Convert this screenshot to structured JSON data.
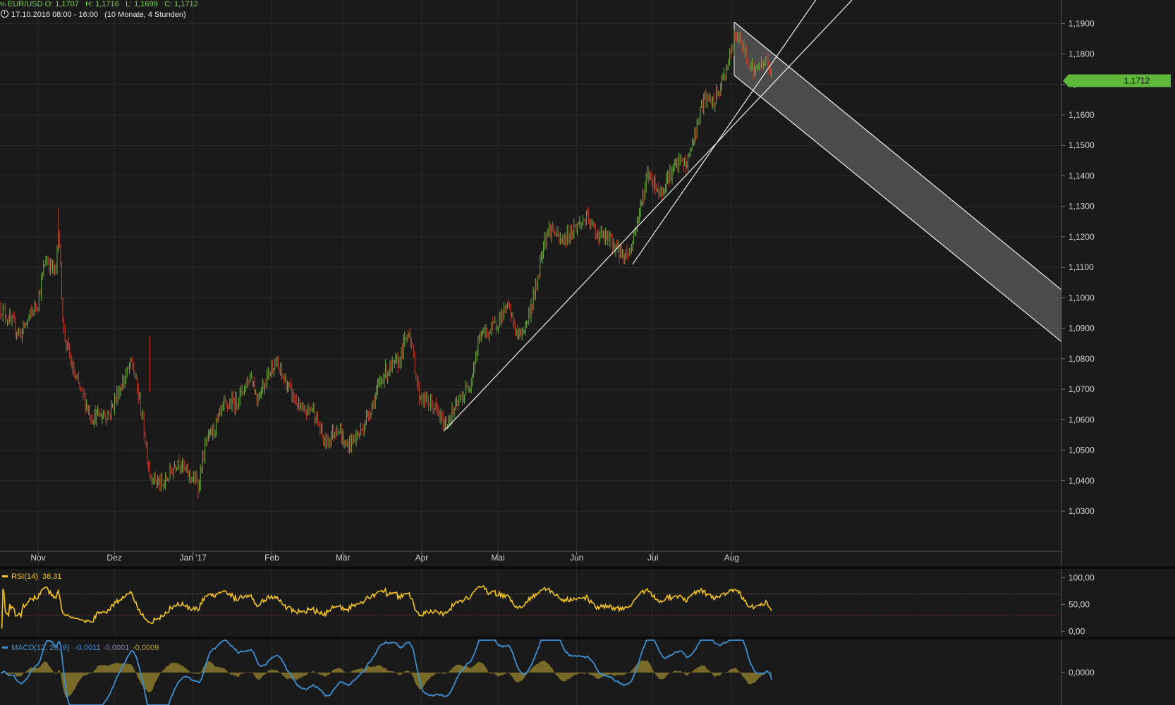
{
  "header": {
    "symbol_icon": "percent-chart-icon",
    "symbol_icon_glyph": "%",
    "symbol": "EUR/USD",
    "ohlc": "O: 1,1707   H: 1,1716   L: 1,1699   C: 1,1712",
    "clock_icon": "clock-icon",
    "period": "17.10.2016 08:00 - 16:00   (10 Monate, 4 Stunden)"
  },
  "last_price_label": "1,1712",
  "colors": {
    "background": "#1a1a1a",
    "grid": "#2b2b2b",
    "up_candle": "#6fae3c",
    "down_candle": "#c53a2c",
    "price_badge": "#5fb83a",
    "trendline": "#f0f0f0",
    "channel_fill": "#666666",
    "rsi_line": "#f5c518",
    "macd_line": "#3d8fd1",
    "macd_hist": "#8a7a2e"
  },
  "chart_data": [
    {
      "type": "candlestick",
      "name": "EUR/USD",
      "x_ticks": [
        "Nov",
        "Dez",
        "Jan '17",
        "Feb",
        "Mär",
        "Apr",
        "Mai",
        "Jun",
        "Jul",
        "Aug"
      ],
      "y_ticks": [
        "1,0300",
        "1,0400",
        "1,0500",
        "1,0600",
        "1,0700",
        "1,0800",
        "1,0900",
        "1,1000",
        "1,1100",
        "1,1200",
        "1,1300",
        "1,1400",
        "1,1500",
        "1,1600",
        "1,1700",
        "1,1800",
        "1,1900"
      ],
      "y_tick_values": [
        1.03,
        1.04,
        1.05,
        1.06,
        1.07,
        1.08,
        1.09,
        1.1,
        1.11,
        1.12,
        1.13,
        1.14,
        1.15,
        1.16,
        1.17,
        1.18,
        1.19
      ],
      "ylim": [
        1.027,
        1.197
      ],
      "date_range": [
        "2016-10-17",
        "2017-08-17"
      ],
      "last": 1.1712,
      "price_path": [
        [
          "2016-10-17",
          1.097
        ],
        [
          "2016-10-25",
          1.088
        ],
        [
          "2016-11-01",
          1.099
        ],
        [
          "2016-11-04",
          1.113
        ],
        [
          "2016-11-08",
          1.108
        ],
        [
          "2016-11-09",
          1.124
        ],
        [
          "2016-11-11",
          1.089
        ],
        [
          "2016-11-15",
          1.075
        ],
        [
          "2016-11-22",
          1.061
        ],
        [
          "2016-11-29",
          1.062
        ],
        [
          "2016-12-02",
          1.068
        ],
        [
          "2016-12-08",
          1.079
        ],
        [
          "2016-12-12",
          1.061
        ],
        [
          "2016-12-15",
          1.042
        ],
        [
          "2016-12-20",
          1.038
        ],
        [
          "2016-12-26",
          1.047
        ],
        [
          "2016-12-29",
          1.043
        ],
        [
          "2017-01-03",
          1.039
        ],
        [
          "2017-01-06",
          1.052
        ],
        [
          "2017-01-11",
          1.06
        ],
        [
          "2017-01-13",
          1.064
        ],
        [
          "2017-01-18",
          1.066
        ],
        [
          "2017-01-24",
          1.075
        ],
        [
          "2017-01-26",
          1.067
        ],
        [
          "2017-02-02",
          1.079
        ],
        [
          "2017-02-06",
          1.073
        ],
        [
          "2017-02-13",
          1.062
        ],
        [
          "2017-02-17",
          1.064
        ],
        [
          "2017-02-22",
          1.052
        ],
        [
          "2017-02-27",
          1.058
        ],
        [
          "2017-03-02",
          1.051
        ],
        [
          "2017-03-08",
          1.056
        ],
        [
          "2017-03-13",
          1.066
        ],
        [
          "2017-03-17",
          1.075
        ],
        [
          "2017-03-23",
          1.079
        ],
        [
          "2017-03-27",
          1.09
        ],
        [
          "2017-03-31",
          1.068
        ],
        [
          "2017-04-06",
          1.064
        ],
        [
          "2017-04-10",
          1.058
        ],
        [
          "2017-04-13",
          1.062
        ],
        [
          "2017-04-18",
          1.069
        ],
        [
          "2017-04-20",
          1.072
        ],
        [
          "2017-04-24",
          1.088
        ],
        [
          "2017-04-28",
          1.089
        ],
        [
          "2017-05-05",
          1.097
        ],
        [
          "2017-05-09",
          1.087
        ],
        [
          "2017-05-12",
          1.091
        ],
        [
          "2017-05-16",
          1.103
        ],
        [
          "2017-05-19",
          1.119
        ],
        [
          "2017-05-22",
          1.123
        ],
        [
          "2017-05-26",
          1.118
        ],
        [
          "2017-05-31",
          1.123
        ],
        [
          "2017-06-05",
          1.126
        ],
        [
          "2017-06-09",
          1.121
        ],
        [
          "2017-06-14",
          1.119
        ],
        [
          "2017-06-19",
          1.114
        ],
        [
          "2017-06-22",
          1.115
        ],
        [
          "2017-06-27",
          1.133
        ],
        [
          "2017-06-29",
          1.141
        ],
        [
          "2017-07-04",
          1.134
        ],
        [
          "2017-07-07",
          1.14
        ],
        [
          "2017-07-12",
          1.145
        ],
        [
          "2017-07-14",
          1.143
        ],
        [
          "2017-07-18",
          1.155
        ],
        [
          "2017-07-21",
          1.165
        ],
        [
          "2017-07-25",
          1.164
        ],
        [
          "2017-07-28",
          1.17
        ],
        [
          "2017-08-01",
          1.181
        ],
        [
          "2017-08-03",
          1.187
        ],
        [
          "2017-08-07",
          1.179
        ],
        [
          "2017-08-10",
          1.174
        ],
        [
          "2017-08-14",
          1.178
        ],
        [
          "2017-08-16",
          1.176
        ],
        [
          "2017-08-17",
          1.1712
        ]
      ],
      "drawings": {
        "trendlines": [
          {
            "from": [
              "2017-04-10",
              1.0565
            ],
            "to": [
              "2017-09-20",
              1.2
            ]
          },
          {
            "from": [
              "2017-06-23",
              1.111
            ],
            "to": [
              "2017-09-05",
              1.2
            ]
          }
        ],
        "channel": {
          "upper": {
            "from": [
              "2017-08-02",
              1.1905
            ],
            "to": [
              "2017-12-20",
              1.095
            ]
          },
          "lower": {
            "from": [
              "2017-08-02",
              1.173
            ],
            "to": [
              "2017-12-20",
              1.078
            ]
          }
        }
      }
    },
    {
      "type": "line",
      "name": "RSI(14)",
      "label": "RSI(14)",
      "value_label": "38,31",
      "last": 38.31,
      "y_ticks": [
        "100,00",
        "50,00",
        "0,00"
      ],
      "y_tick_values": [
        100,
        50,
        0
      ],
      "ylim": [
        -10,
        110
      ],
      "upper_band": 70,
      "lower_band": 30
    },
    {
      "type": "line",
      "name": "MACD(12, 26, 9)",
      "label": "MACD(12, 26, 9)",
      "values_label": [
        "-0,0011",
        "-0,0001",
        "-0,0009"
      ],
      "macd": -0.0011,
      "signal": -0.0001,
      "histogram": -0.0009,
      "y_ticks": [
        "0,0000"
      ],
      "y_tick_values": [
        0
      ],
      "ylim": [
        -0.005,
        0.005
      ]
    }
  ]
}
